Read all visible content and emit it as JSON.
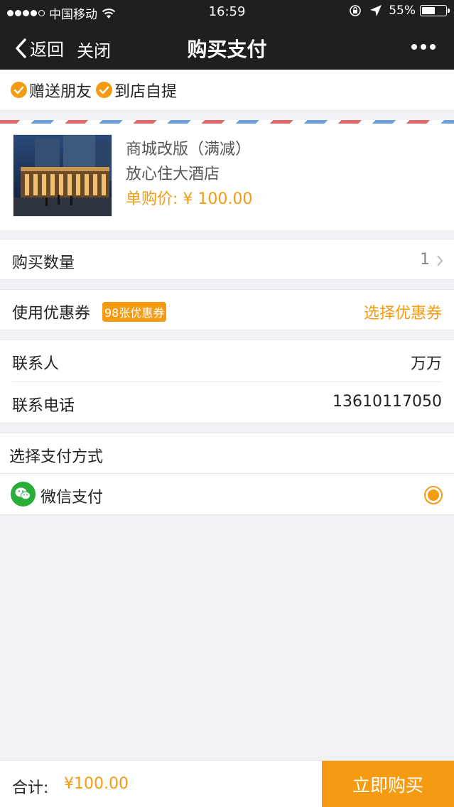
{
  "status": {
    "carrier": "中国移动",
    "time": "16:59",
    "battery": "55%",
    "battery_level": 0.55,
    "signal_bars_filled": 4
  },
  "nav": {
    "back_label": "返回",
    "close_label": "关闭",
    "title": "购买支付"
  },
  "options": [
    {
      "label": "赠送朋友",
      "checked": true
    },
    {
      "label": "到店自提",
      "checked": true
    }
  ],
  "product": {
    "name": "商城改版（满减）",
    "hotel": "放心住大酒店",
    "price": "单购价: ¥ 100.00"
  },
  "quantity": {
    "label": "购买数量",
    "value": "1"
  },
  "coupon": {
    "label": "使用优惠券",
    "badge": "98张优惠券",
    "action": "选择优惠券"
  },
  "contact": {
    "name_label": "联系人",
    "name_value": "万万",
    "phone_label": "联系电话",
    "phone_value": "13610117050"
  },
  "payment": {
    "title": "选择支付方式",
    "method": "微信支付",
    "selected": true
  },
  "footer": {
    "total_label": "合计:",
    "total_value": "¥100.00",
    "buy_label": "立即购买"
  },
  "colors": {
    "accent": "#f59b12",
    "nav_bg": "#1f1f21",
    "wechat_green": "#2bad3a"
  }
}
